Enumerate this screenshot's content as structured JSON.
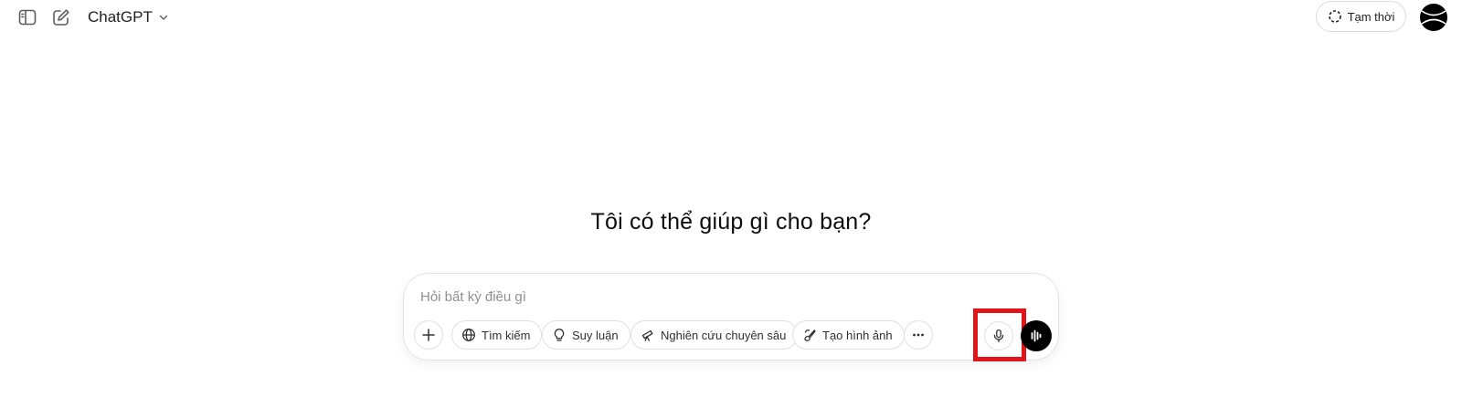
{
  "header": {
    "model_name": "ChatGPT",
    "temp_chat_label": "Tạm thời"
  },
  "main": {
    "headline": "Tôi có thể giúp gì cho bạn?"
  },
  "composer": {
    "placeholder": "Hỏi bất kỳ điều gì",
    "value": "",
    "tools": [
      {
        "label": "Tìm kiếm",
        "icon": "globe-icon"
      },
      {
        "label": "Suy luận",
        "icon": "lightbulb-icon"
      },
      {
        "label": "Nghiên cứu chuyên sâu",
        "icon": "telescope-icon"
      },
      {
        "label": "Tạo hình ảnh",
        "icon": "image-brush-icon"
      }
    ]
  },
  "icons": {
    "sidebar_toggle": "sidebar-toggle-icon",
    "new_chat": "new-chat-icon",
    "model_dropdown": "chevron-down-icon",
    "temp_chat": "dashed-circle-icon",
    "attach": "plus-icon",
    "more": "ellipsis-icon",
    "dictate": "microphone-icon",
    "voice": "voice-waveform-icon"
  },
  "colors": {
    "highlight": "#e0141a",
    "voice_button": "#000000",
    "border": "#e0e0e0"
  }
}
